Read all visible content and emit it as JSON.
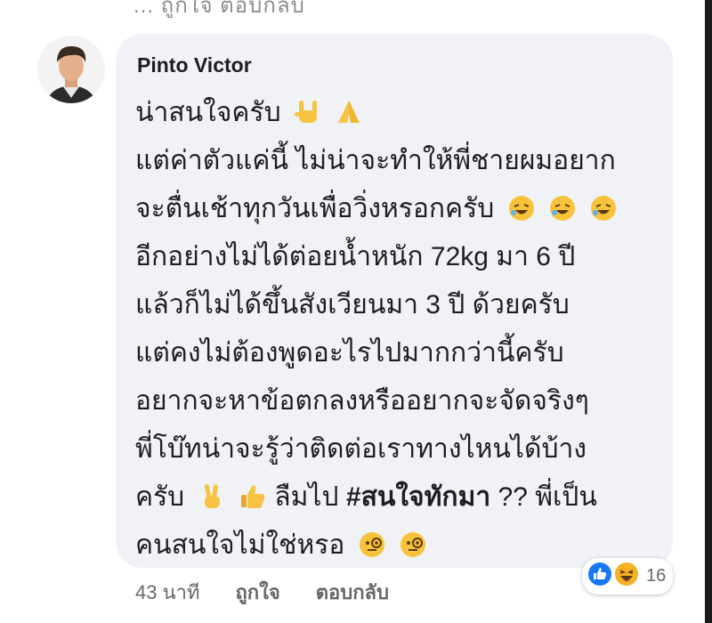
{
  "top_partial_text": "... ถูกใจ ตอบกลับ",
  "comment": {
    "author": "Pinto Victor",
    "lines": [
      "น่าสนใจครับ",
      "แต่ค่าตัวแค่นี้ ไม่น่าจะทำให้พี่ชายผมอยาก",
      "จะตื่นเช้าทุกวันเพื่อวิ่งหรอกครับ",
      "อีกอย่างไม่ได้ต่อยน้ำหนัก 72kg มา 6 ปี",
      "แล้วก็ไม่ได้ขึ้นสังเวียนมา 3 ปี ด้วยครับ",
      "แต่คงไม่ต้องพูดอะไรไปมากกว่านี้ครับ",
      "อยากจะหาข้อตกลงหรืออยากจะจัดจริงๆ",
      "พี่โบ๊ทน่าจะรู้ว่าติดต่อเราทางไหนได้บ้าง",
      "ครับ",
      "คนสนใจไม่ใช่หรอ"
    ],
    "line9_mid": "ลืมไป",
    "hashtag": "#สนใจทักมา",
    "line9_tail": "?? พี่เป็น",
    "emoji_names": [
      "rock-on-hand-icon",
      "folded-hands-icon",
      "rofl-face-icon",
      "victory-hand-icon",
      "thumbs-up-icon",
      "monocle-face-icon"
    ]
  },
  "footer": {
    "time": "43 นาที",
    "like": "ถูกใจ",
    "reply": "ตอบกลับ"
  },
  "reactions": {
    "count": "16",
    "types": [
      "like-reaction-icon",
      "haha-reaction-icon"
    ],
    "colors": {
      "like": "#1877f2",
      "haha": "#f7b125"
    }
  }
}
